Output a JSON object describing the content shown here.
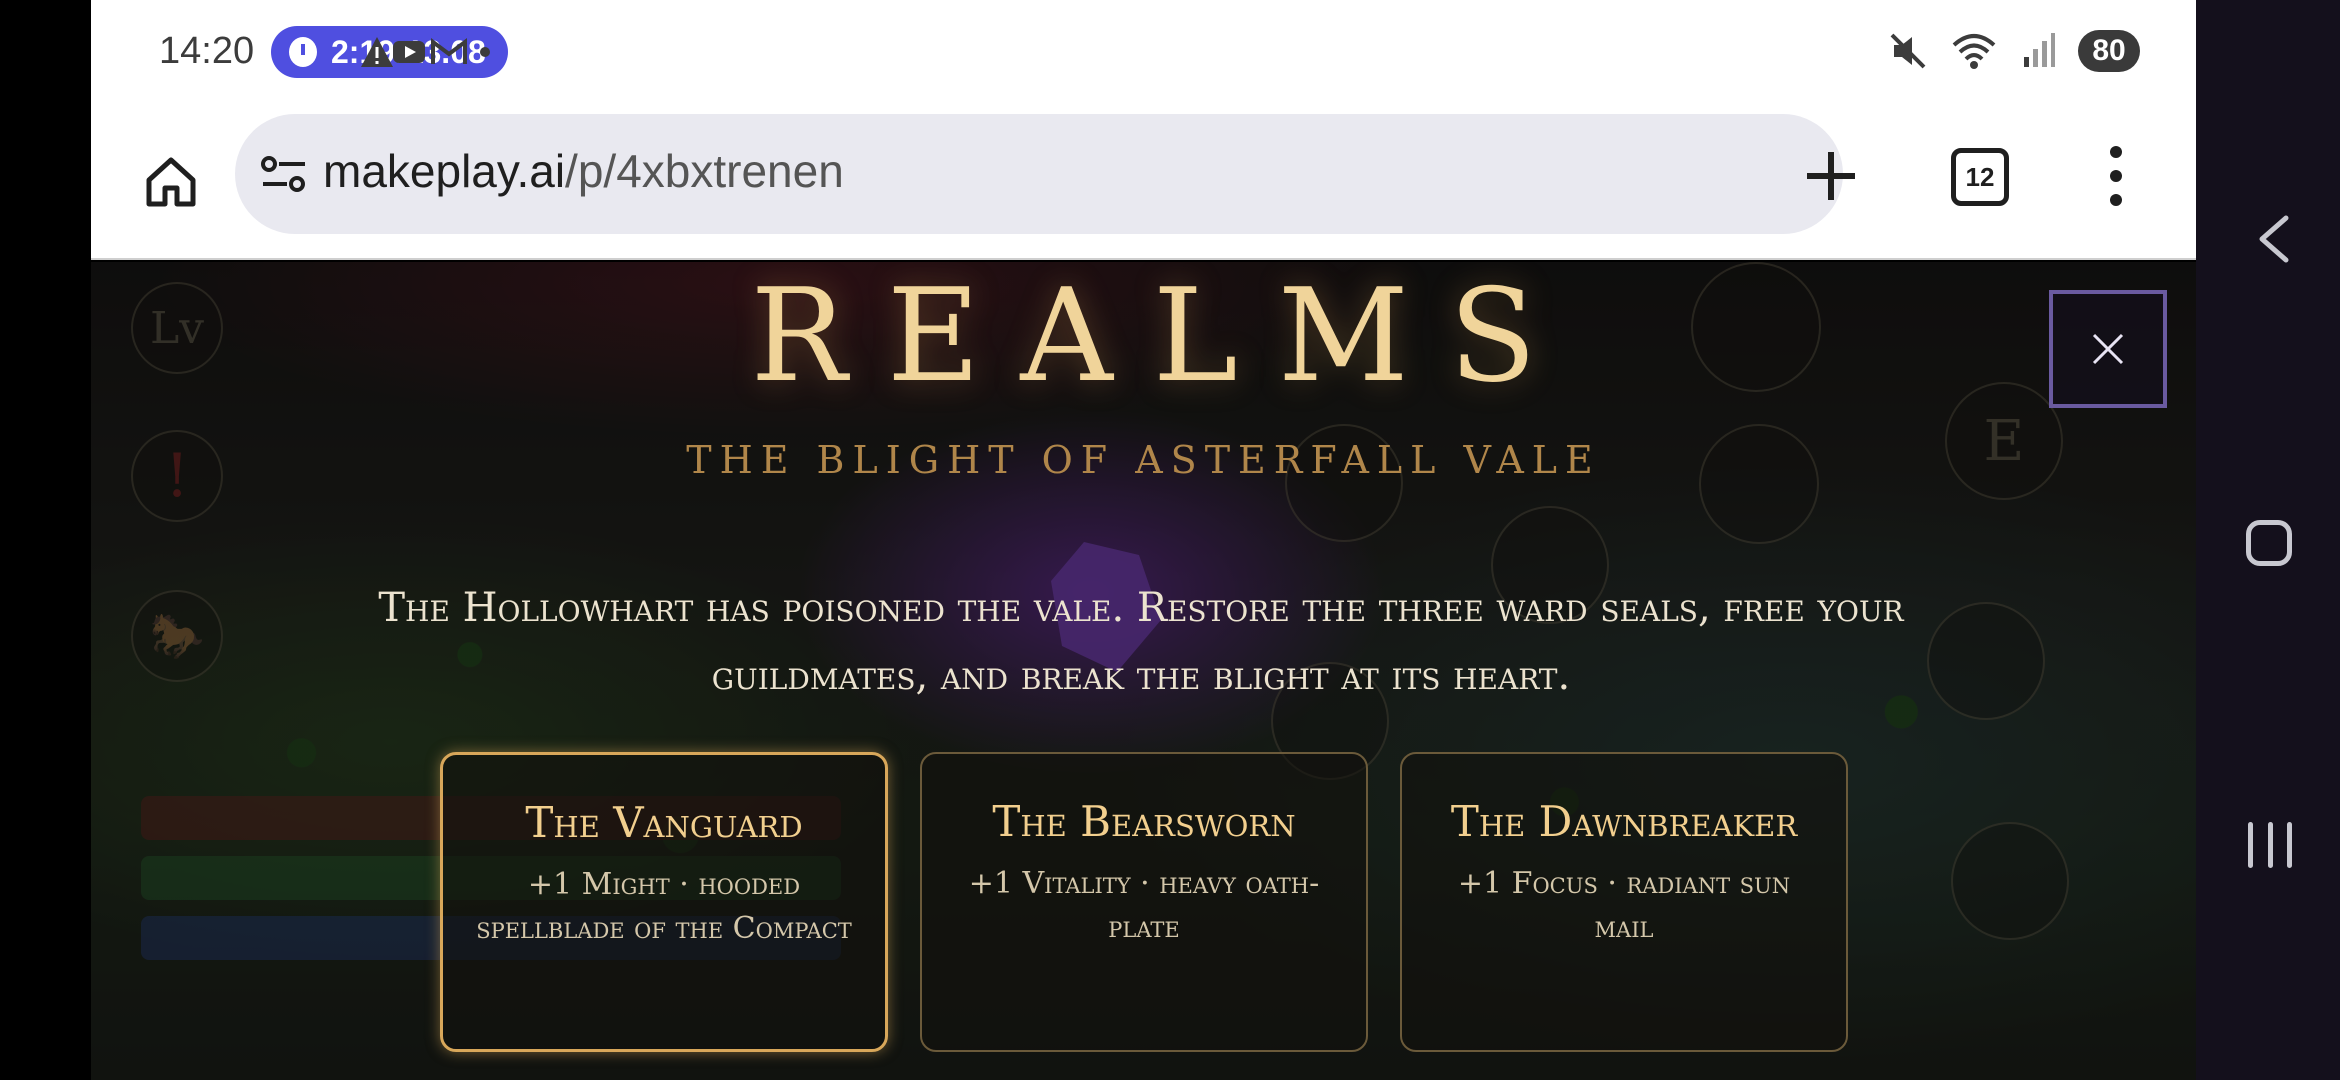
{
  "status_bar": {
    "time": "14:20",
    "timer": "2:19:13.08",
    "icons": [
      "warning-icon",
      "youtube-icon",
      "gmail-icon",
      "dot-icon"
    ],
    "right_icons": [
      "mute-icon",
      "wifi-icon",
      "signal-icon"
    ],
    "battery": "80"
  },
  "browser": {
    "url_domain": "makeplay.ai",
    "url_path": "/p/4xbxtrenen",
    "tab_count": "12",
    "actions": [
      "home-icon",
      "site-settings-icon",
      "new-tab-icon",
      "tabs-icon",
      "more-options-icon"
    ]
  },
  "game": {
    "title": "REALMS",
    "subtitle": "THE BLIGHT OF ASTERFALL VALE",
    "description": "The Hollowhart has poisoned the vale. Restore the three ward seals, free your guildmates, and break the blight at its heart.",
    "close_label": "×",
    "hud_left": [
      "Lv",
      "!",
      "🐎"
    ],
    "hud_right": [
      "E"
    ],
    "cards": [
      {
        "title": "The Vanguard",
        "desc": "+1 Might · hooded spellblade of the Compact",
        "selected": true
      },
      {
        "title": "The Bearsworn",
        "desc": "+1 Vitality · heavy oath-plate",
        "selected": false
      },
      {
        "title": "The Dawnbreaker",
        "desc": "+1 Focus · radiant sun mail",
        "selected": false
      }
    ]
  },
  "colors": {
    "title_gold": "#f0d49a",
    "subtitle_bronze": "#b0864a",
    "card_border": "#6b5a3a",
    "card_border_selected": "#d8a75a",
    "timer_pill": "#4f4fe0",
    "close_border": "#6a5aa0"
  }
}
